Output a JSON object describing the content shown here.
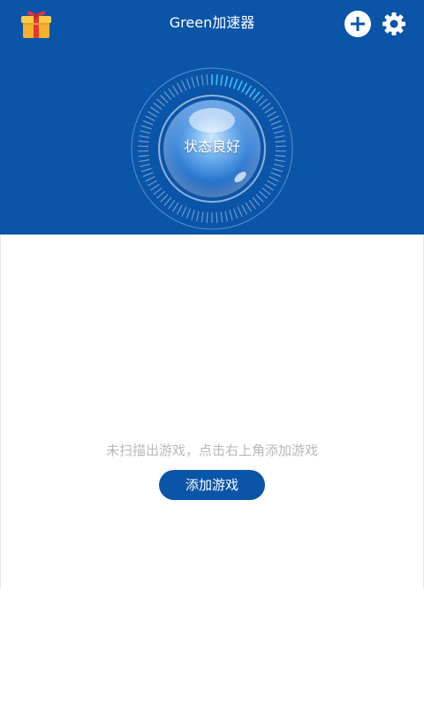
{
  "header": {
    "title": "Green加速器",
    "gift_icon": "gift-icon",
    "add_icon": "plus-circle-icon",
    "settings_icon": "gear-icon",
    "background_color": "#0b55a8"
  },
  "status": {
    "label": "状态良好",
    "progress": 0.12,
    "accent_color": "#37c6f0"
  },
  "empty_state": {
    "message": "未扫描出游戏，点击右上角添加游戏",
    "button_label": "添加游戏"
  }
}
